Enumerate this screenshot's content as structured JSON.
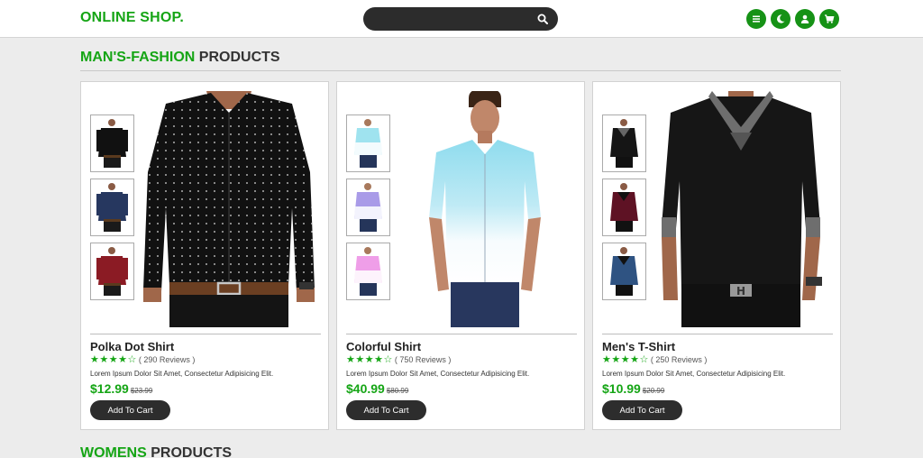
{
  "header": {
    "logo": "ONLINE SHOP.",
    "search_placeholder": "",
    "icons": [
      "menu-icon",
      "moon-icon",
      "user-icon",
      "cart-icon"
    ],
    "accent_color": "#15a515"
  },
  "section_mens": {
    "accent": "MAN'S-FASHION",
    "rest": " PRODUCTS"
  },
  "section_womens": {
    "accent": "WOMENS",
    "rest": " PRODUCTS"
  },
  "products": [
    {
      "name": "Polka Dot Shirt",
      "rating": 4,
      "reviews": "( 290 Reviews )",
      "description": "Lorem Ipsum Dolor Sit Amet, Consectetur Adipisicing Elit.",
      "price": "$12.99",
      "old_price": "$23.99",
      "button": "Add To Cart"
    },
    {
      "name": "Colorful Shirt",
      "rating": 4,
      "reviews": "( 750 Reviews )",
      "description": "Lorem Ipsum Dolor Sit Amet, Consectetur Adipisicing Elit.",
      "price": "$40.99",
      "old_price": "$80.99",
      "button": "Add To Cart"
    },
    {
      "name": "Men's T-Shirt",
      "rating": 4,
      "reviews": "( 250 Reviews )",
      "description": "Lorem Ipsum Dolor Sit Amet, Consectetur Adipisicing Elit.",
      "price": "$10.99",
      "old_price": "$20.99",
      "button": "Add To Cart"
    }
  ]
}
